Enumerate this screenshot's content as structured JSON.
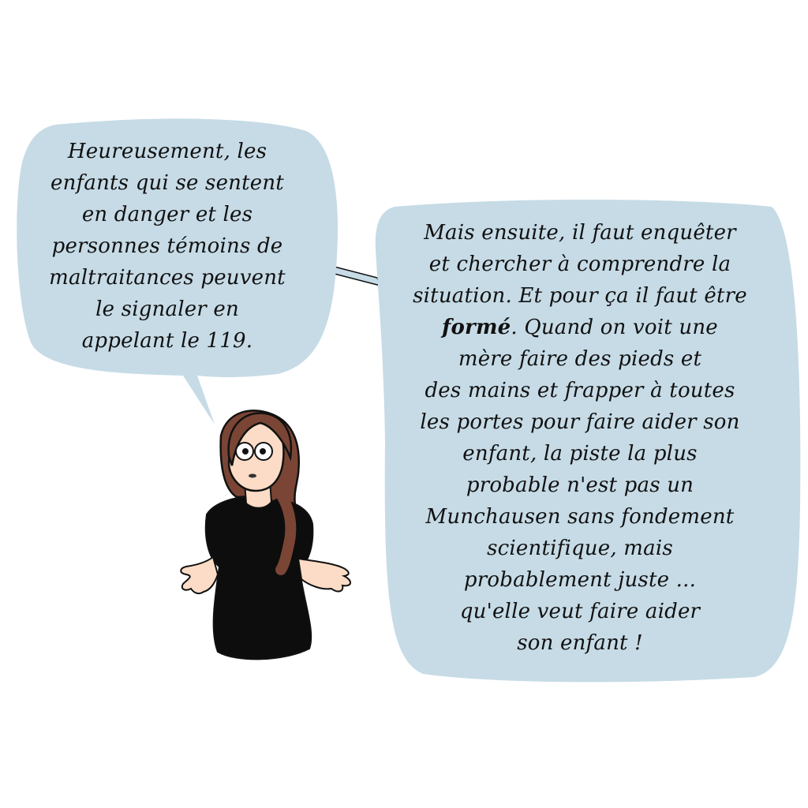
{
  "colors": {
    "bubble_fill": "#c6dbe6",
    "outline": "#111111",
    "hair": "#7a4535",
    "skin": "#fcdcc6",
    "shirt": "#0d0d0d"
  },
  "left_bubble": {
    "lines": [
      "Heureusement, les",
      "enfants qui se sentent",
      "en danger et les",
      "personnes  témoins de",
      "maltraitances peuvent",
      "le signaler en",
      "appelant le 119."
    ]
  },
  "right_bubble": {
    "line_1": "Mais ensuite, il faut enquêter",
    "line_2": "et chercher à comprendre la",
    "line_3": "situation. Et pour ça il faut être",
    "line_4_bold": "formé",
    "line_4_rest": ". Quand on voit une",
    "line_5": "mère faire des pieds et",
    "line_6": "des mains et frapper à toutes",
    "line_7": "les portes pour faire aider son",
    "line_8": "enfant, la piste la plus",
    "line_9": "probable n'est pas un",
    "line_10": "Munchausen sans fondement",
    "line_11": "scientifique, mais",
    "line_12": "probablement juste ...",
    "line_13": "qu'elle veut faire aider",
    "line_14": "son enfant !"
  }
}
